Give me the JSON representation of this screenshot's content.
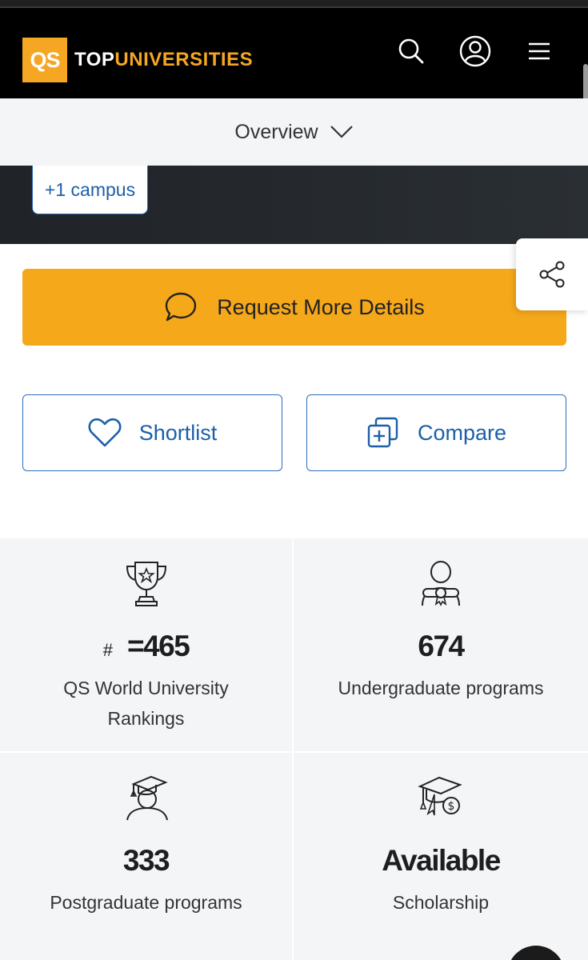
{
  "header": {
    "logo_mark": "QS",
    "logo_top": "TOP",
    "logo_universities": "UNIVERSITIES",
    "icons": [
      "search-icon",
      "user-icon",
      "menu-icon"
    ]
  },
  "subnav": {
    "label": "Overview"
  },
  "hero": {
    "campus_label": "+1 campus"
  },
  "actions": {
    "request_label": "Request More Details",
    "shortlist_label": "Shortlist",
    "compare_label": "Compare"
  },
  "stats": [
    {
      "icon": "trophy-icon",
      "prefix": "#",
      "value": "=465",
      "label": "QS World University Rankings"
    },
    {
      "icon": "graduate-diploma-icon",
      "value": "674",
      "label": "Undergraduate programs"
    },
    {
      "icon": "postgraduate-cap-icon",
      "value": "333",
      "label": "Postgraduate programs"
    },
    {
      "icon": "scholarship-icon",
      "value": "Available",
      "label": "Scholarship"
    }
  ],
  "colors": {
    "brand_yellow": "#f5a81a",
    "link_blue": "#1c5fa8",
    "header_bg": "#000000",
    "panel_bg": "#f3f5f7"
  }
}
